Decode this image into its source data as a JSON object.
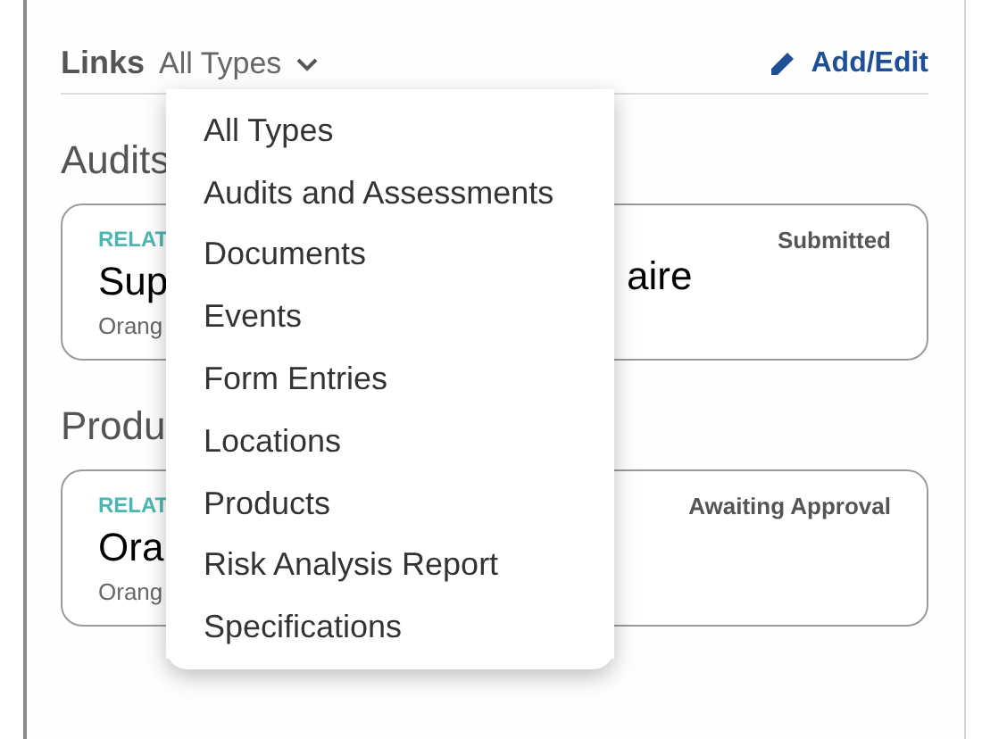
{
  "links_header": {
    "title": "Links",
    "filter": "All Types",
    "action": "Add/Edit"
  },
  "sections": [
    {
      "heading": "Audits",
      "card": {
        "tag": "RELAT",
        "status": "Submitted",
        "title_left": "Sup",
        "title_right": "aire",
        "subtitle": "Orang"
      }
    },
    {
      "heading": "Produ",
      "card": {
        "tag": "RELAT",
        "status": "Awaiting Approval",
        "title_left": "Ora",
        "subtitle": "Orang"
      }
    }
  ],
  "dropdown": {
    "items": [
      {
        "label": "All Types",
        "selected": false
      },
      {
        "label": "Audits and Assessments",
        "selected": false
      },
      {
        "label": "Documents",
        "selected": false
      },
      {
        "label": "Events",
        "selected": false
      },
      {
        "label": "Form Entries",
        "selected": false
      },
      {
        "label": "Locations",
        "selected": false
      },
      {
        "label": "Products",
        "selected": false
      },
      {
        "label": "Risk Analysis Report",
        "selected": false
      },
      {
        "label": "Specifications",
        "selected": false
      }
    ]
  }
}
